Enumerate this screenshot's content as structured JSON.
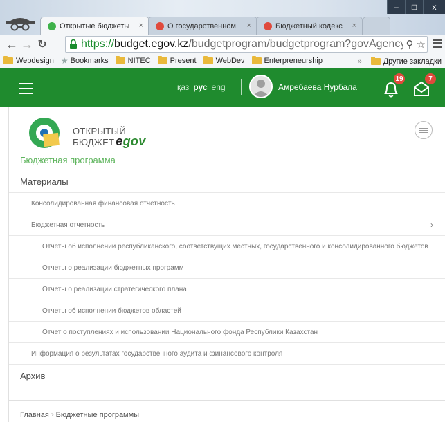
{
  "browser": {
    "tabs": [
      {
        "title": "Открытые бюджеты",
        "active": true,
        "favicon_color": "#3fb24b"
      },
      {
        "title": "О государственном",
        "active": false,
        "favicon_color": "#e04a3c"
      },
      {
        "title": "Бюджетный кодекс",
        "active": false,
        "favicon_color": "#e04a3c"
      }
    ],
    "window_controls": {
      "minimize": "–",
      "maximize": "□",
      "close": "x"
    },
    "url": {
      "scheme": "https://",
      "host": "budget.egov.kz",
      "path": "/budgetprogram/budgetprogram?govAgencyId"
    },
    "bookmarks": [
      "Webdesign",
      "Bookmarks",
      "NITEC",
      "Present",
      "WebDev",
      "Enterpreneurship"
    ],
    "bookmarks_more": "»",
    "other_bookmarks": "Другие закладки"
  },
  "header": {
    "bg_color": "#1f8b2e",
    "languages": [
      "қаз",
      "рус",
      "eng"
    ],
    "active_language": "рус",
    "user_name": "Амребаева Нурбала",
    "notifications_count": "19",
    "messages_count": "7"
  },
  "logo": {
    "line1": "ОТКРЫТЫЙ",
    "line2": "БЮДЖЕТ",
    "brand_e": "e",
    "brand_gov": "gov"
  },
  "page": {
    "section_title": "Бюджетная программа",
    "menu": [
      {
        "label": "Материалы",
        "level": 0
      },
      {
        "label": "Консолидированная финансовая отчетность",
        "level": 1
      },
      {
        "label": "Бюджетная отчетность",
        "level": 1,
        "has_arrow": true
      },
      {
        "label": "Отчеты об исполнении республиканского, соответствущих местных, государственного и консолидированного бюджетов",
        "level": 2
      },
      {
        "label": "Отчеты о реализации бюджетных программ",
        "level": 2
      },
      {
        "label": "Отчеты о реализации стратегического плана",
        "level": 2
      },
      {
        "label": "Отчеты об исполнении бюджетов областей",
        "level": 2
      },
      {
        "label": "Отчет о поступлениях и использовании Национального фонда Республики Казахстан",
        "level": 2
      },
      {
        "label": "Информация о результатах государственного аудита и финансового контроля",
        "level": 1
      },
      {
        "label": "Архив",
        "level": 0
      }
    ],
    "breadcrumb": {
      "home": "Главная",
      "separator": "›",
      "current": "Бюджетные программы"
    }
  }
}
